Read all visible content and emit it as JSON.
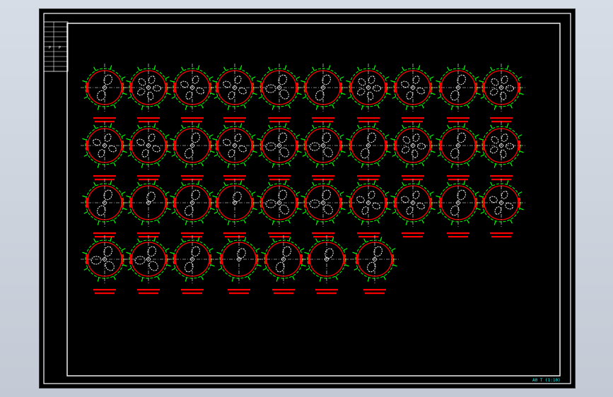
{
  "sheet": {
    "title_block_text": "A0 T (1:10)",
    "header_marks": [
      "P",
      "P"
    ]
  },
  "colors": {
    "background": "#000000",
    "frame": "#ffffff",
    "circle": "#ff0000",
    "dimension": "#00ff00",
    "hole": "#ffffff",
    "label": "#ff0000",
    "title_text": "#00ffff",
    "desktop": "#cdd3dc"
  },
  "views": [
    {
      "row": 0,
      "holes": 2
    },
    {
      "row": 0,
      "holes": 5
    },
    {
      "row": 0,
      "holes": 4
    },
    {
      "row": 0,
      "holes": 4
    },
    {
      "row": 0,
      "holes": 3
    },
    {
      "row": 0,
      "holes": 2
    },
    {
      "row": 0,
      "holes": 5
    },
    {
      "row": 0,
      "holes": 4
    },
    {
      "row": 0,
      "holes": 2
    },
    {
      "row": 0,
      "holes": 5
    },
    {
      "row": 1,
      "holes": 4
    },
    {
      "row": 1,
      "holes": 4
    },
    {
      "row": 1,
      "holes": 2
    },
    {
      "row": 1,
      "holes": 4
    },
    {
      "row": 1,
      "holes": 3
    },
    {
      "row": 1,
      "holes": 3
    },
    {
      "row": 1,
      "holes": 2
    },
    {
      "row": 1,
      "holes": 5
    },
    {
      "row": 1,
      "holes": 2
    },
    {
      "row": 1,
      "holes": 5
    },
    {
      "row": 2,
      "holes": 2
    },
    {
      "row": 2,
      "holes": 1
    },
    {
      "row": 2,
      "holes": 2
    },
    {
      "row": 2,
      "holes": 1
    },
    {
      "row": 2,
      "holes": 3
    },
    {
      "row": 2,
      "holes": 3
    },
    {
      "row": 2,
      "holes": 4
    },
    {
      "row": 2,
      "holes": 4
    },
    {
      "row": 2,
      "holes": 2
    },
    {
      "row": 2,
      "holes": 4
    },
    {
      "row": 3,
      "holes": 3
    },
    {
      "row": 3,
      "holes": 3
    },
    {
      "row": 3,
      "holes": 2
    },
    {
      "row": 3,
      "holes": 1
    },
    {
      "row": 3,
      "holes": 2
    },
    {
      "row": 3,
      "holes": 1
    },
    {
      "row": 3,
      "holes": 2
    }
  ]
}
